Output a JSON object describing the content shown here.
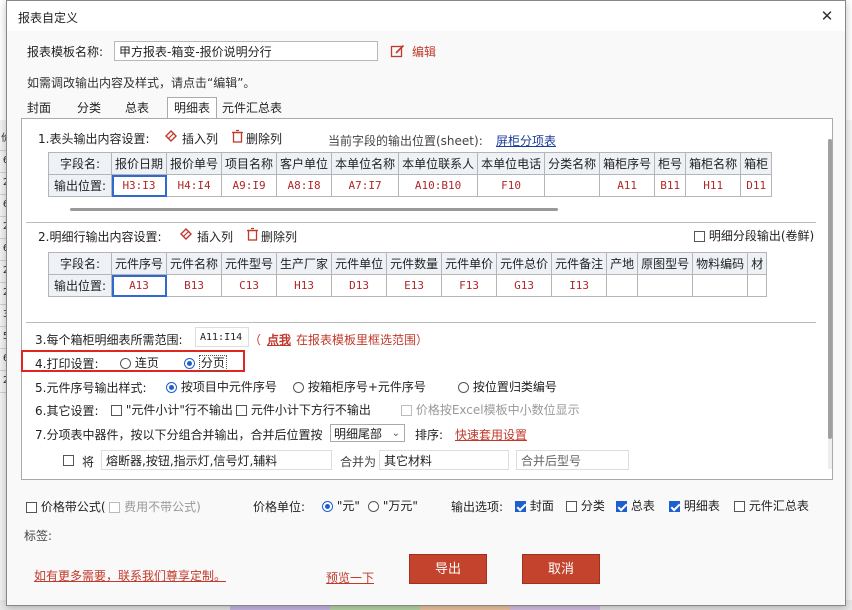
{
  "dialog": {
    "title": "报表自定义",
    "close_glyph": "✕"
  },
  "template": {
    "name_label": "报表模板名称:",
    "name_value": "甲方报表-箱变-报价说明分行",
    "edit_label": "编辑",
    "hint": "如需调改输出内容及样式，请点击“编辑”。"
  },
  "tabs": [
    "封面",
    "分类",
    "总表",
    "明细表",
    "元件汇总表"
  ],
  "active_tab": "明细表",
  "section1": {
    "title": "1.表头输出内容设置:",
    "insert_col": "插入列",
    "delete_col": "删除列",
    "sheet_pos_label": "当前字段的输出位置(sheet):",
    "sheet_pos_value": "屏柜分项表",
    "row_labels": [
      "字段名:",
      "输出位置:"
    ],
    "headers": [
      "报价日期",
      "报价单号",
      "项目名称",
      "客户单位",
      "本单位名称",
      "本单位联系人",
      "本单位电话",
      "分类名称",
      "箱柜序号",
      "柜号",
      "箱柜名称",
      "箱柜"
    ],
    "positions": [
      "H3:I3",
      "H4:I4",
      "A9:I9",
      "A8:I8",
      "A7:I7",
      "A10:B10",
      "F10",
      "",
      "A11",
      "B11",
      "H11",
      "D11"
    ]
  },
  "section2": {
    "title": "2.明细行输出内容设置:",
    "insert_col": "插入列",
    "delete_col": "删除列",
    "segment_label": "明细分段输出(卷鲜)",
    "row_labels": [
      "字段名:",
      "输出位置:"
    ],
    "headers": [
      "元件序号",
      "元件名称",
      "元件型号",
      "生产厂家",
      "元件单位",
      "元件数量",
      "元件单价",
      "元件总价",
      "元件备注",
      "产地",
      "原图型号",
      "物料编码",
      "材"
    ],
    "positions": [
      "A13",
      "B13",
      "C13",
      "H13",
      "D13",
      "E13",
      "F13",
      "G13",
      "I13",
      "",
      "",
      "",
      ""
    ]
  },
  "section3": {
    "label": "3.每个箱柜明细表所需范围:",
    "value": "A11:I14",
    "paren_open": "（",
    "click_label": "点我",
    "click_hint": "在报表模板里框选范围）"
  },
  "section4": {
    "label": "4.打印设置:",
    "opt1": "连页",
    "opt2": "分页",
    "selected": "分页"
  },
  "section5": {
    "label": "5.元件序号输出样式:",
    "opt1": "按项目中元件序号",
    "opt2": "按箱柜序号+元件序号",
    "opt3": "按位置归类编号"
  },
  "section6": {
    "label": "6.其它设置:",
    "opt1": "\"元件小计\"行不输出",
    "opt2": "元件小计下方行不输出",
    "opt3": "价格按Excel模板中小数位显示"
  },
  "section7": {
    "label": "7.分项表中器件，按以下分组合并输出，合并后位置按",
    "position_value": "明细尾部",
    "sort_label": "排序:",
    "quick_label": "快速套用设置",
    "merge_prefix": "将",
    "merge_items": "熔断器,按钮,指示灯,信号灯,辅料",
    "merge_as": "合并为",
    "merge_target": "其它材料",
    "merge_model_placeholder": "合并后型号"
  },
  "bottom": {
    "price_formula": "价格带公式(",
    "no_formula_fee": "费用不带公式)",
    "price_unit_label": "价格单位:",
    "unit_yuan": "\"元\"",
    "unit_wan": "\"万元\"",
    "output_label": "输出选项:",
    "out_cover": "封面",
    "out_category": "分类",
    "out_summary": "总表",
    "out_detail": "明细表",
    "out_components": "元件汇总表",
    "tag_label": "标签:",
    "custom_link": "如有更多需要，联系我们尊享定制。",
    "preview_link": "预览一下",
    "export_button": "导出",
    "cancel_button": "取消"
  },
  "background_rows": [
    "价",
    "6",
    "2",
    "6",
    "2",
    "6",
    "2",
    "2",
    "3",
    "5",
    "6",
    "2"
  ],
  "colors": {
    "accent_red": "#c4432d",
    "link_red": "#c0392b",
    "check_blue": "#1d5fcf",
    "highlight_border": "#e0261e"
  }
}
